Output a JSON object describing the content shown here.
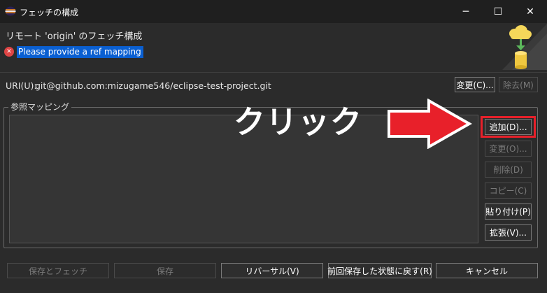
{
  "window": {
    "title": "フェッチの構成",
    "minimize_glyph": "─",
    "maximize_glyph": "☐",
    "close_glyph": "✕"
  },
  "header": {
    "title": "リモート 'origin' のフェッチ構成",
    "error_icon_glyph": "✕",
    "error_message": "Please provide a ref mapping"
  },
  "uri": {
    "label": "URI(U):",
    "value": "git@github.com:mizugame546/eclipse-test-project.git",
    "change_button": "変更(C)...",
    "remove_button": "除去(M)"
  },
  "ref_mapping": {
    "group_label": "参照マッピング",
    "buttons": {
      "add": "追加(D)...",
      "modify": "変更(O)...",
      "delete": "削除(D)",
      "copy": "コピー(C)",
      "paste": "貼り付け(P)",
      "advanced": "拡張(V)..."
    }
  },
  "annotation": {
    "text": "クリック",
    "arrow_color": "#e8202a"
  },
  "footer": {
    "save_and_fetch": "保存とフェッチ",
    "save": "保存",
    "revert": "リバーサル(V)",
    "restore": "前回保存した状態に戻す(R)",
    "cancel": "キャンセル"
  }
}
